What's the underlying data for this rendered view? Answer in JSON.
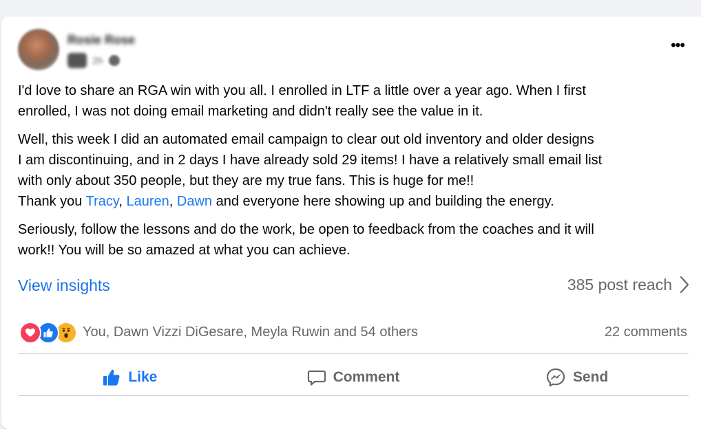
{
  "post": {
    "author": "Rosie Rose",
    "time": "2h",
    "more_label": "•••",
    "paragraphs": [
      [
        "I'd love to share an RGA win with you all. I enrolled in LTF a little over a year ago. When I first",
        "enrolled, I was not doing email marketing and didn't really see the value in it."
      ],
      [
        "Well, this week I did an automated email campaign to clear out old inventory and older designs",
        "I am discontinuing, and in 2 days I have already sold 29 items! I have a relatively small email list",
        "with only about 350 people, but they are my true fans.  This is huge for me!!"
      ],
      [
        "Seriously, follow the lessons and do the work, be open to feedback from the coaches and it will",
        "work!!  You will be so amazed at what you can achieve."
      ]
    ],
    "thanks": {
      "prefix": "Thank you ",
      "mentions": [
        "Tracy",
        "Lauren",
        "Dawn"
      ],
      "separator": ", ",
      "suffix": " and everyone here showing up and building the energy."
    }
  },
  "insights": {
    "view_label": "View insights",
    "reach_label": "385 post reach"
  },
  "reactions": {
    "icons": [
      "love-icon",
      "like-icon",
      "wow-icon"
    ],
    "summary": "You, Dawn Vizzi DiGesare, Meyla Ruwin and 54 others",
    "comments": "22 comments"
  },
  "actions": {
    "like": "Like",
    "comment": "Comment",
    "send": "Send"
  },
  "colors": {
    "accent": "#1877f2",
    "secondary_text": "#65676b",
    "love": "#f33e58",
    "wow": "#f7b125"
  }
}
